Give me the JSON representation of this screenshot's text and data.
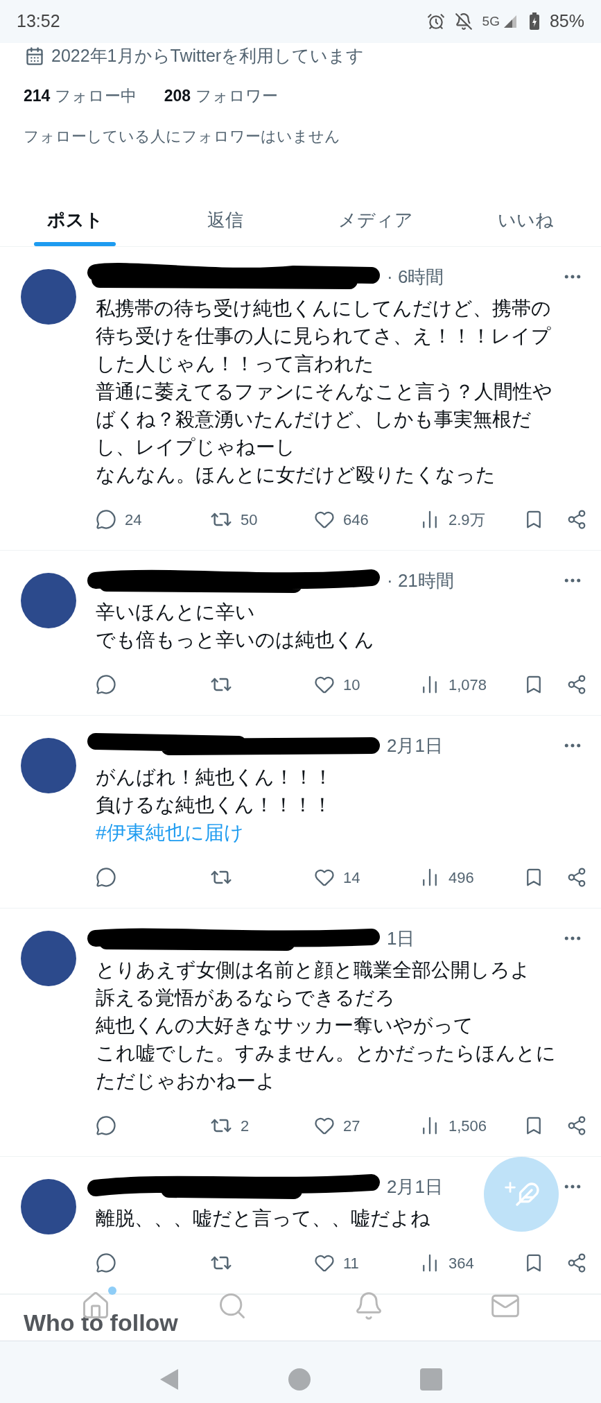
{
  "status_bar": {
    "time": "13:52",
    "network": "5G",
    "battery": "85%"
  },
  "profile": {
    "joined": "2022年1月からTwitterを利用しています",
    "following_count": "214",
    "following_label": "フォロー中",
    "followers_count": "208",
    "followers_label": "フォロワー",
    "followers_note": "フォローしている人にフォロワーはいません"
  },
  "tabs": [
    {
      "label": "ポスト",
      "selected": true
    },
    {
      "label": "返信",
      "selected": false
    },
    {
      "label": "メディア",
      "selected": false
    },
    {
      "label": "いいね",
      "selected": false
    }
  ],
  "posts": [
    {
      "time": "· 6時間",
      "lines": [
        "私携帯の待ち受け純也くんにしてんだけど、携帯の",
        "待ち受けを仕事の人に見られてさ、え！！！レイプ",
        "した人じゃん！！って言われた",
        "普通に萎えてるファンにそんなこと言う？人間性や",
        "ばくね？殺意湧いたんだけど、しかも事実無根だ",
        "し、レイプじゃねーし",
        "なんなん。ほんとに女だけど殴りたくなった"
      ],
      "stats": {
        "replies": "24",
        "reposts": "50",
        "likes": "646",
        "views": "2.9万"
      }
    },
    {
      "time": "· 21時間",
      "lines": [
        "辛いほんとに辛い",
        "でも倍もっと辛いのは純也くん"
      ],
      "stats": {
        "likes": "10",
        "views": "1,078"
      }
    },
    {
      "time": "2月1日",
      "lines": [
        "がんばれ！純也くん！！！",
        "負けるな純也くん！！！！"
      ],
      "hashtag": "#伊東純也に届け",
      "stats": {
        "likes": "14",
        "views": "496"
      }
    },
    {
      "time": "1日",
      "lines": [
        "とりあえず女側は名前と顔と職業全部公開しろよ",
        "訴える覚悟があるならできるだろ",
        "純也くんの大好きなサッカー奪いやがって",
        "これ嘘でした。すみません。とかだったらほんとに",
        "ただじゃおかねーよ"
      ],
      "stats": {
        "reposts": "2",
        "likes": "27",
        "views": "1,506"
      }
    },
    {
      "time": "2月1日",
      "lines": [
        "離脱、、、嘘だと言って、、嘘だよね"
      ],
      "stats": {
        "likes": "11",
        "views": "364"
      }
    }
  ],
  "who_to_follow": {
    "title": "Who to follow"
  }
}
